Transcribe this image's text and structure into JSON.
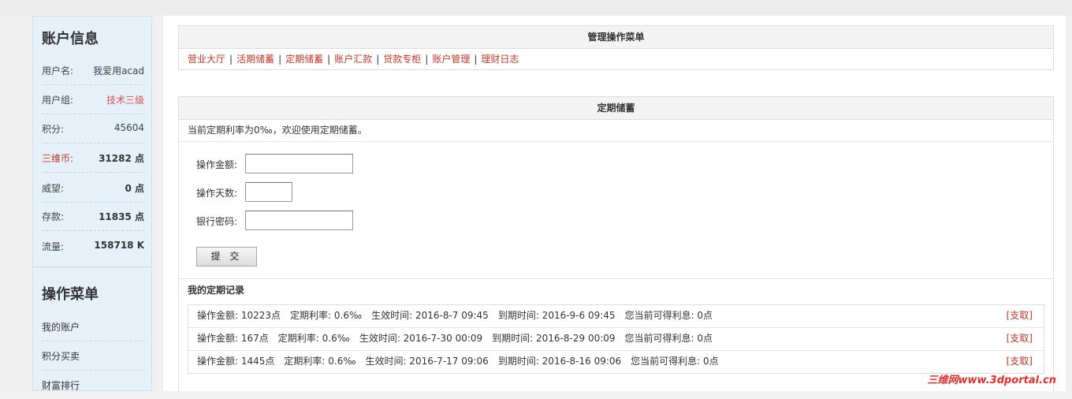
{
  "breadcrumb": [
    "",
    ""
  ],
  "sidebar": {
    "account_title": "账户信息",
    "account_rows": [
      {
        "label": "用户名:",
        "value": "我爱用acad"
      },
      {
        "label": "用户组:",
        "value": "技术三级"
      },
      {
        "label": "积分:",
        "value": "45604"
      },
      {
        "label": "三维币:",
        "value": "31282 点"
      },
      {
        "label": "威望:",
        "value": "0 点"
      },
      {
        "label": "存款:",
        "value": "11835 点"
      },
      {
        "label": "流量:",
        "value": "158718 K"
      }
    ],
    "menu_title": "操作菜单",
    "menu_items": [
      "我的账户",
      "积分买卖",
      "财富排行"
    ]
  },
  "manage_menu": {
    "title": "管理操作菜单",
    "links": [
      "营业大厅",
      "活期储蓄",
      "定期储蓄",
      "账户汇款",
      "贷款专柜",
      "账户管理",
      "理财日志"
    ]
  },
  "fixed_deposit": {
    "title": "定期储蓄",
    "notice": "当前定期利率为0‰，欢迎使用定期储蓄。",
    "amount_label": "操作金额:",
    "days_label": "操作天数:",
    "password_label": "银行密码:",
    "submit_label": "提 交",
    "records_title": "我的定期记录",
    "records": [
      {
        "amount": "操作金额: 10223点",
        "rate": "定期利率: 0.6‰",
        "start": "生效时间: 2016-8-7 09:45",
        "end": "到期时间: 2016-9-6 09:45",
        "interest": "您当前可得利息: 0点",
        "action": "[支取]"
      },
      {
        "amount": "操作金额: 167点",
        "rate": "定期利率: 0.6‰",
        "start": "生效时间: 2016-7-30 00:09",
        "end": "到期时间: 2016-8-29 00:09",
        "interest": "您当前可得利息: 0点",
        "action": "[支取]"
      },
      {
        "amount": "操作金额: 1445点",
        "rate": "定期利率: 0.6‰",
        "start": "生效时间: 2016-7-17 09:06",
        "end": "到期时间: 2016-8-16 09:06",
        "interest": "您当前可得利息: 0点",
        "action": "[支取]"
      }
    ]
  },
  "watermark": "三维网www.3dportal.cn",
  "colors": {
    "link_red": "#c0392b",
    "sidebar_bg": "#e6f0f9"
  }
}
